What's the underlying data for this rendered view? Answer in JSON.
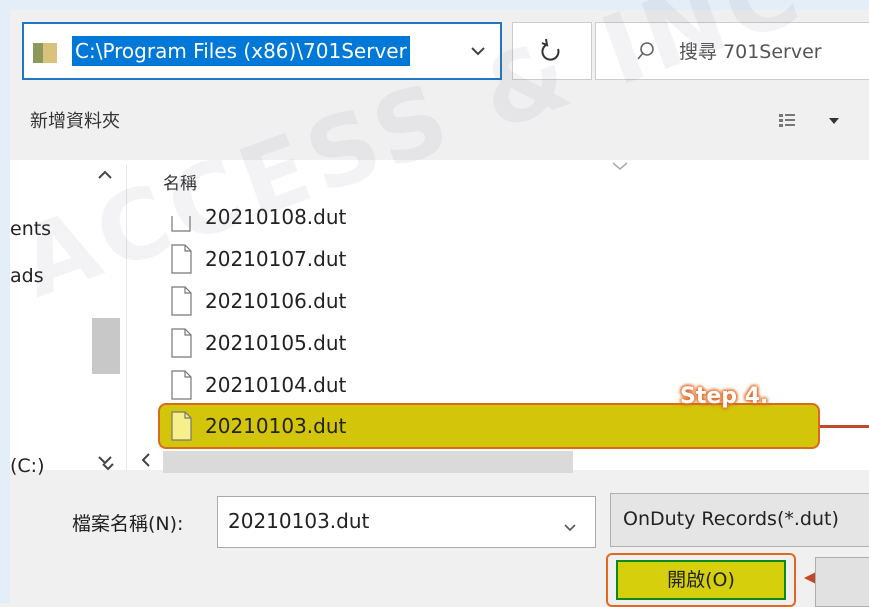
{
  "address_bar": {
    "path": "C:\\Program Files (x86)\\701Server"
  },
  "search": {
    "text": "搜尋 701Server"
  },
  "toolbar": {
    "new_folder_label": "新增資料夾"
  },
  "nav_pane": {
    "items": [
      {
        "label": "ents"
      },
      {
        "label": "ads"
      },
      {
        "label": "(C:)"
      }
    ]
  },
  "file_list": {
    "column_name": "名稱",
    "files": [
      {
        "name": "20210108.dut"
      },
      {
        "name": "20210107.dut"
      },
      {
        "name": "20210106.dut"
      },
      {
        "name": "20210105.dut"
      },
      {
        "name": "20210104.dut"
      },
      {
        "name": "20210103.dut",
        "selected": true
      }
    ]
  },
  "annotation": {
    "step_label": "Step 4."
  },
  "footer": {
    "filename_label": "檔案名稱(N):",
    "filename_value": "20210103.dut",
    "filetype_value": "OnDuty Records(*.dut)",
    "open_button_label": "開啟(O)"
  },
  "colors": {
    "highlight": "#d2c50a",
    "annotation_orange": "#d86b1c",
    "open_button_border": "#0b8a1a",
    "selection_blue": "#0078d7"
  }
}
